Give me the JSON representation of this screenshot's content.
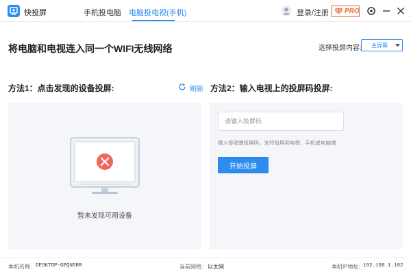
{
  "app": {
    "name": "快投屏"
  },
  "tabs": [
    {
      "label": "手机投电脑",
      "active": false
    },
    {
      "label": "电脑投电视(手机)",
      "active": true
    }
  ],
  "header": {
    "login_label": "登录/注册",
    "pro_label": "PRO"
  },
  "main": {
    "heading": "将电脑和电视连入同一个WIFI无线网络",
    "select_label": "选择投屏内容:",
    "select_value": "主屏幕"
  },
  "method1": {
    "title": "方法1：点击发现的设备投屏:",
    "refresh_label": "刷新",
    "empty_text": "暂未发现可用设备"
  },
  "method2": {
    "title": "方法2：输入电视上的投屏码投屏:",
    "input_placeholder": "请输入投屏码",
    "input_value": "",
    "hint": "输入接收端投屏码，支持投屏到电视、手机或电脑端",
    "start_label": "开始投屏"
  },
  "footer": {
    "pc_name_label": "本机名称:",
    "pc_name_value": "DESKTOP-GEQN5RR",
    "network_label": "当前网络:",
    "network_value": "以太网",
    "ip_label": "本机IP地址:",
    "ip_value": "192.168.1.102"
  },
  "colors": {
    "accent": "#2d8cf0",
    "pro": "#e8734d",
    "panel_bg": "#f4f6fa",
    "error": "#f0685c"
  },
  "icons": {
    "logo": "app-logo-icon",
    "user": "user-icon",
    "pro": "diamond-icon",
    "settings": "settings-icon",
    "minimize": "minimize-icon",
    "close": "close-icon",
    "refresh": "refresh-icon",
    "monitor": "monitor-error-icon"
  }
}
